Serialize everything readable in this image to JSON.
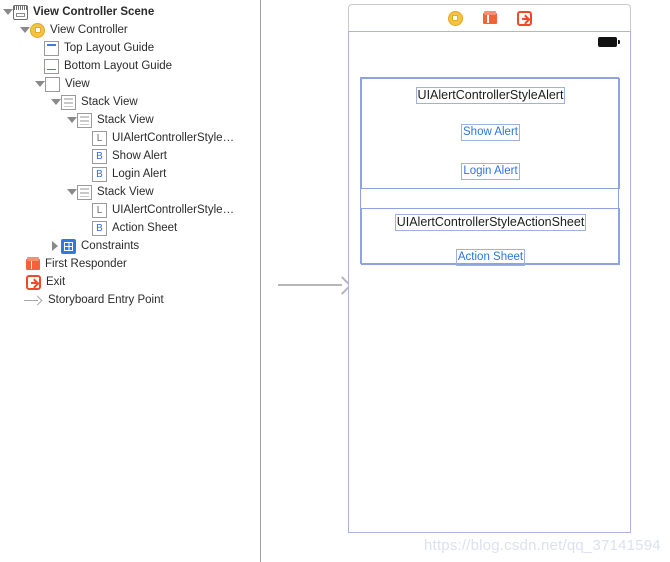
{
  "outline": {
    "rows": [
      {
        "label": "View Controller Scene",
        "indent": 2,
        "disclosure": "open",
        "icon": "scene-icon",
        "bold": true
      },
      {
        "label": "View Controller",
        "indent": 19,
        "disclosure": "open",
        "icon": "view-controller-icon",
        "bold": false
      },
      {
        "label": "Top Layout Guide",
        "indent": 44,
        "disclosure": "none",
        "icon": "top-layout-guide-icon",
        "bold": false
      },
      {
        "label": "Bottom Layout Guide",
        "indent": 44,
        "disclosure": "none",
        "icon": "bottom-layout-guide-icon",
        "bold": false
      },
      {
        "label": "View",
        "indent": 34,
        "disclosure": "open",
        "icon": "view-icon",
        "bold": false
      },
      {
        "label": "Stack View",
        "indent": 50,
        "disclosure": "open",
        "icon": "stack-view-icon",
        "bold": false
      },
      {
        "label": "Stack View",
        "indent": 66,
        "disclosure": "open",
        "icon": "stack-view-icon",
        "bold": false
      },
      {
        "label": "UIAlertControllerStyle…",
        "indent": 92,
        "disclosure": "none",
        "icon": "label-icon",
        "bold": false
      },
      {
        "label": "Show Alert",
        "indent": 92,
        "disclosure": "none",
        "icon": "button-icon",
        "bold": false
      },
      {
        "label": "Login Alert",
        "indent": 92,
        "disclosure": "none",
        "icon": "button-icon",
        "bold": false
      },
      {
        "label": "Stack View",
        "indent": 66,
        "disclosure": "open",
        "icon": "stack-view-icon",
        "bold": false
      },
      {
        "label": "UIAlertControllerStyle…",
        "indent": 92,
        "disclosure": "none",
        "icon": "label-icon",
        "bold": false
      },
      {
        "label": "Action Sheet",
        "indent": 92,
        "disclosure": "none",
        "icon": "button-icon",
        "bold": false
      },
      {
        "label": "Constraints",
        "indent": 50,
        "disclosure": "closed",
        "icon": "constraints-icon",
        "bold": false
      },
      {
        "label": "First Responder",
        "indent": 26,
        "disclosure": "none",
        "icon": "first-responder-icon",
        "bold": false
      },
      {
        "label": "Exit",
        "indent": 26,
        "disclosure": "none",
        "icon": "exit-icon",
        "bold": false
      },
      {
        "label": "Storyboard Entry Point",
        "indent": 24,
        "disclosure": "none",
        "icon": "entry-point-arrow-icon",
        "bold": false
      }
    ],
    "icon_letters": {
      "label": "L",
      "button": "B"
    }
  },
  "canvas": {
    "scene_dock": {
      "icons": [
        {
          "name": "view-controller-dock-icon",
          "color": "#f5c243"
        },
        {
          "name": "first-responder-dock-icon",
          "color": "#f4623a"
        },
        {
          "name": "exit-dock-icon",
          "color": "#ef4b2b"
        }
      ]
    },
    "status_bar": {
      "battery": "battery-full-icon"
    },
    "alert_group": {
      "title": "UIAlertControllerStyleAlert",
      "buttons": [
        "Show Alert",
        "Login Alert"
      ]
    },
    "sheet_group": {
      "title": "UIAlertControllerStyleActionSheet",
      "buttons": [
        "Action Sheet"
      ]
    },
    "entry_arrow": "storyboard-entry-arrow"
  },
  "watermark": {
    "text": "https://blog.csdn.net/qq_37141594"
  },
  "colors": {
    "selection_blue": "#8fa3e0",
    "button_text": "#2f74df",
    "vc_yellow": "#f5c243",
    "responder_orange": "#f4623a",
    "exit_red": "#ef4b2b",
    "constraints_blue": "#2d7ae5"
  }
}
